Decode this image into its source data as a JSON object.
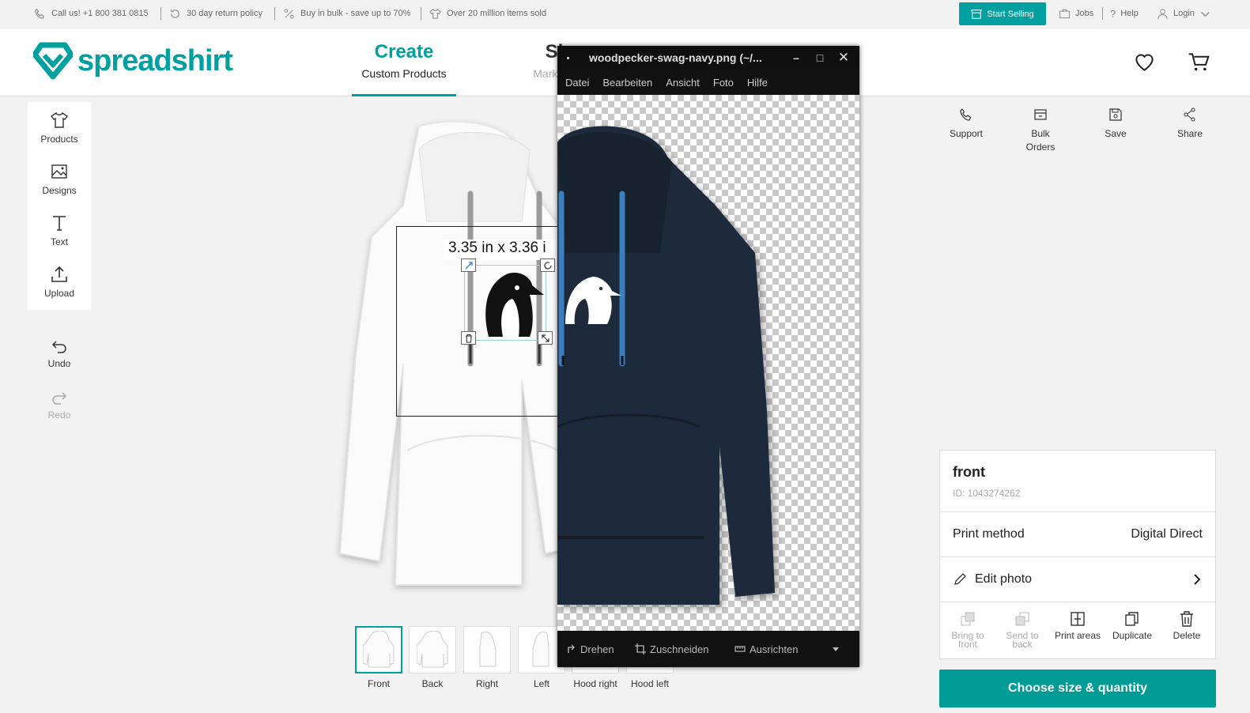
{
  "topbar": {
    "promos": [
      "Call us! +1 800 381 0815",
      "30 day return policy",
      "Buy in bulk - save up to 70%",
      "Over 20 million items sold"
    ],
    "start_selling": "Start Selling",
    "jobs": "Jobs",
    "help": "Help",
    "login": "Login"
  },
  "header": {
    "logo": "spreadshirt",
    "nav": [
      {
        "title": "Create",
        "subtitle": "Custom Products"
      },
      {
        "title": "Sh",
        "subtitle": "Marketpla"
      }
    ]
  },
  "tools": [
    "Products",
    "Designs",
    "Text",
    "Upload"
  ],
  "history": {
    "undo": "Undo",
    "redo": "Redo"
  },
  "design": {
    "dimensions": "3.35 in x 3.36 i"
  },
  "thumbnails": [
    {
      "label": "Front",
      "active": true
    },
    {
      "label": "Back"
    },
    {
      "label": "Right"
    },
    {
      "label": "Left"
    },
    {
      "label": "Hood right"
    },
    {
      "label": "Hood left"
    }
  ],
  "right_actions": [
    "Support",
    "Bulk Orders",
    "Save",
    "Share"
  ],
  "panel": {
    "title": "front",
    "id": "ID: 1043274262",
    "print_method_label": "Print method",
    "print_method_value": "Digital Direct",
    "edit_photo": "Edit photo",
    "actions": [
      {
        "label": "Bring to front",
        "enabled": false
      },
      {
        "label": "Send to back",
        "enabled": false
      },
      {
        "label": "Print areas",
        "enabled": true
      },
      {
        "label": "Duplicate",
        "enabled": true
      },
      {
        "label": "Delete",
        "enabled": true
      }
    ]
  },
  "cta": "Choose size & quantity",
  "viewer": {
    "title": "woodpecker-swag-navy.png (~/...",
    "menu": [
      "Datei",
      "Bearbeiten",
      "Ansicht",
      "Foto",
      "Hilfe"
    ],
    "bottom": [
      "Drehen",
      "Zuschneiden",
      "Ausrichten"
    ]
  },
  "colors": {
    "accent": "#00a0a0",
    "cta": "#009b94",
    "navy_hoodie": "#1f2a3a",
    "drawstring": "#3b7fc0"
  }
}
